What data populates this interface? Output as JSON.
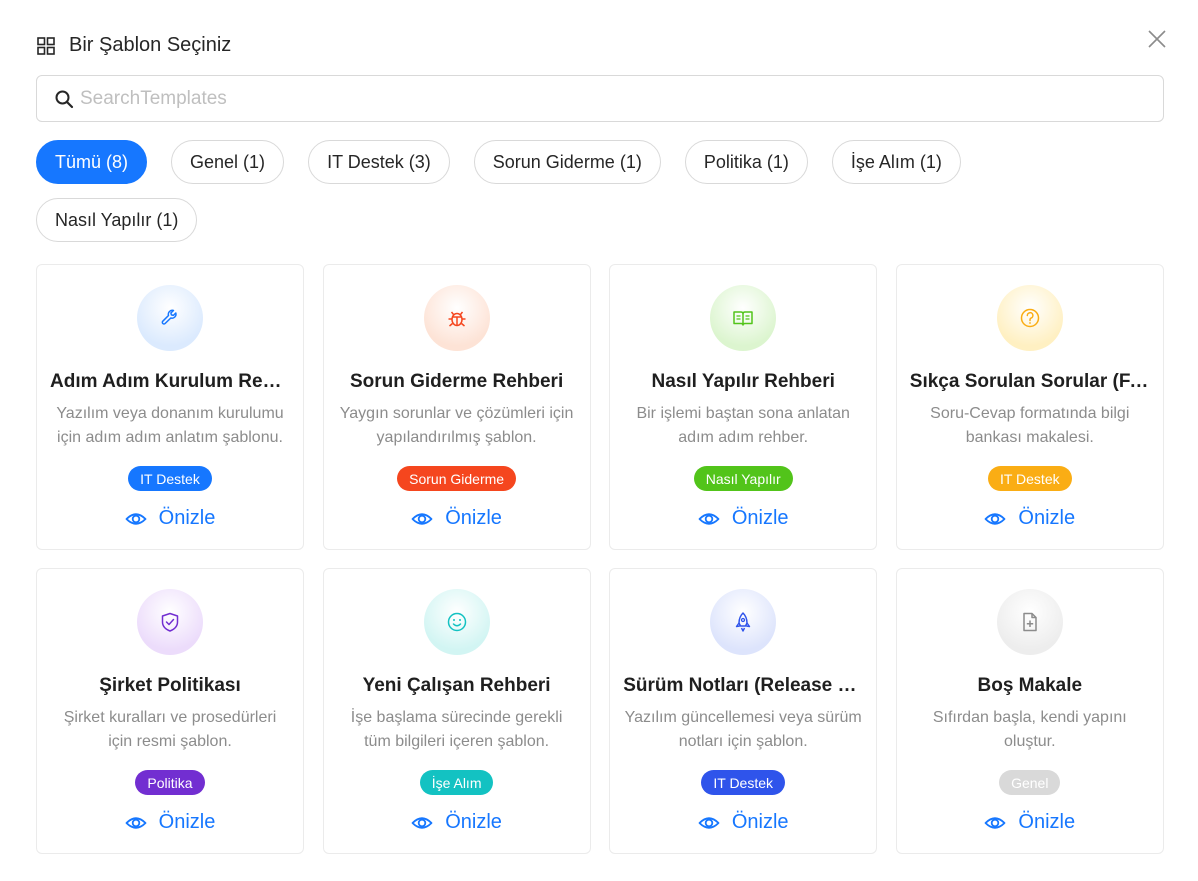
{
  "header": {
    "title": "Bir Şablon Seçiniz"
  },
  "search": {
    "placeholder": "SearchTemplates",
    "value": ""
  },
  "filters": [
    {
      "label": "Tümü (8)",
      "active": true
    },
    {
      "label": "Genel (1)",
      "active": false
    },
    {
      "label": "IT Destek (3)",
      "active": false
    },
    {
      "label": "Sorun Giderme (1)",
      "active": false
    },
    {
      "label": "Politika (1)",
      "active": false
    },
    {
      "label": "İşe Alım (1)",
      "active": false
    },
    {
      "label": "Nasıl Yapılır (1)",
      "active": false
    }
  ],
  "preview_label": "Önizle",
  "cards": [
    {
      "title": "Adım Adım Kurulum Rehberi",
      "desc": "Yazılım veya donanım kurulumu için adım adım anlatım şablonu.",
      "tag": "IT Destek",
      "tag_color": "#1677ff",
      "icon": "wrench-icon",
      "icon_color": "#1677ff",
      "circle_bg": "#dbeafe"
    },
    {
      "title": "Sorun Giderme Rehberi",
      "desc": "Yaygın sorunlar ve çözümleri için yapılandırılmış şablon.",
      "tag": "Sorun Giderme",
      "tag_color": "#f5461e",
      "icon": "bug-icon",
      "icon_color": "#f5461e",
      "circle_bg": "#fde3d6"
    },
    {
      "title": "Nasıl Yapılır Rehberi",
      "desc": "Bir işlemi baştan sona anlatan adım adım rehber.",
      "tag": "Nasıl Yapılır",
      "tag_color": "#52c41a",
      "icon": "book-icon",
      "icon_color": "#52c41a",
      "circle_bg": "#dcf5cf"
    },
    {
      "title": "Sıkça Sorulan Sorular (FAQ)",
      "desc": "Soru-Cevap formatında bilgi bankası makalesi.",
      "tag": "IT Destek",
      "tag_color": "#faad14",
      "icon": "question-icon",
      "icon_color": "#faad14",
      "circle_bg": "#fff0c2"
    },
    {
      "title": "Şirket Politikası",
      "desc": "Şirket kuralları ve prosedürleri için resmi şablon.",
      "tag": "Politika",
      "tag_color": "#722ed1",
      "icon": "shield-icon",
      "icon_color": "#722ed1",
      "circle_bg": "#ecdcfb"
    },
    {
      "title": "Yeni Çalışan Rehberi",
      "desc": "İşe başlama sürecinde gerekli tüm bilgileri içeren şablon.",
      "tag": "İşe Alım",
      "tag_color": "#13c2c2",
      "icon": "smile-icon",
      "icon_color": "#13c2c2",
      "circle_bg": "#d2f5f3"
    },
    {
      "title": "Sürüm Notları (Release Notes)",
      "desc": "Yazılım güncellemesi veya sürüm notları için şablon.",
      "tag": "IT Destek",
      "tag_color": "#2f54eb",
      "icon": "rocket-icon",
      "icon_color": "#2f54eb",
      "circle_bg": "#dde4fc"
    },
    {
      "title": "Boş Makale",
      "desc": "Sıfırdan başla, kendi yapını oluştur.",
      "tag": "Genel",
      "tag_color": "#d9d9d9",
      "icon": "file-add-icon",
      "icon_color": "#8c8c8c",
      "circle_bg": "#ededed"
    }
  ]
}
